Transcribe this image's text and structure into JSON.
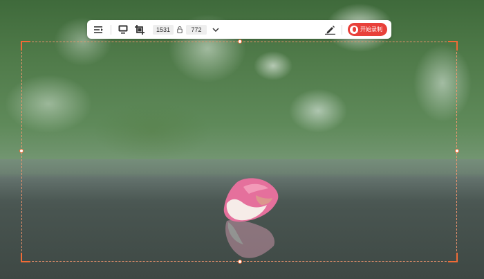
{
  "toolbar": {
    "width_value": "1531",
    "height_value": "772",
    "record_label": "开始录制",
    "icons": {
      "menu": "list-indent-icon",
      "monitor": "monitor-icon",
      "crop": "crop-icon",
      "lock": "lock-ratio-icon",
      "dropdown": "chevron-down-icon",
      "draw": "pen-draw-icon",
      "record": "record-icon"
    },
    "accent_color": "#e8403a"
  },
  "selection": {
    "border_color": "#f26b36"
  }
}
